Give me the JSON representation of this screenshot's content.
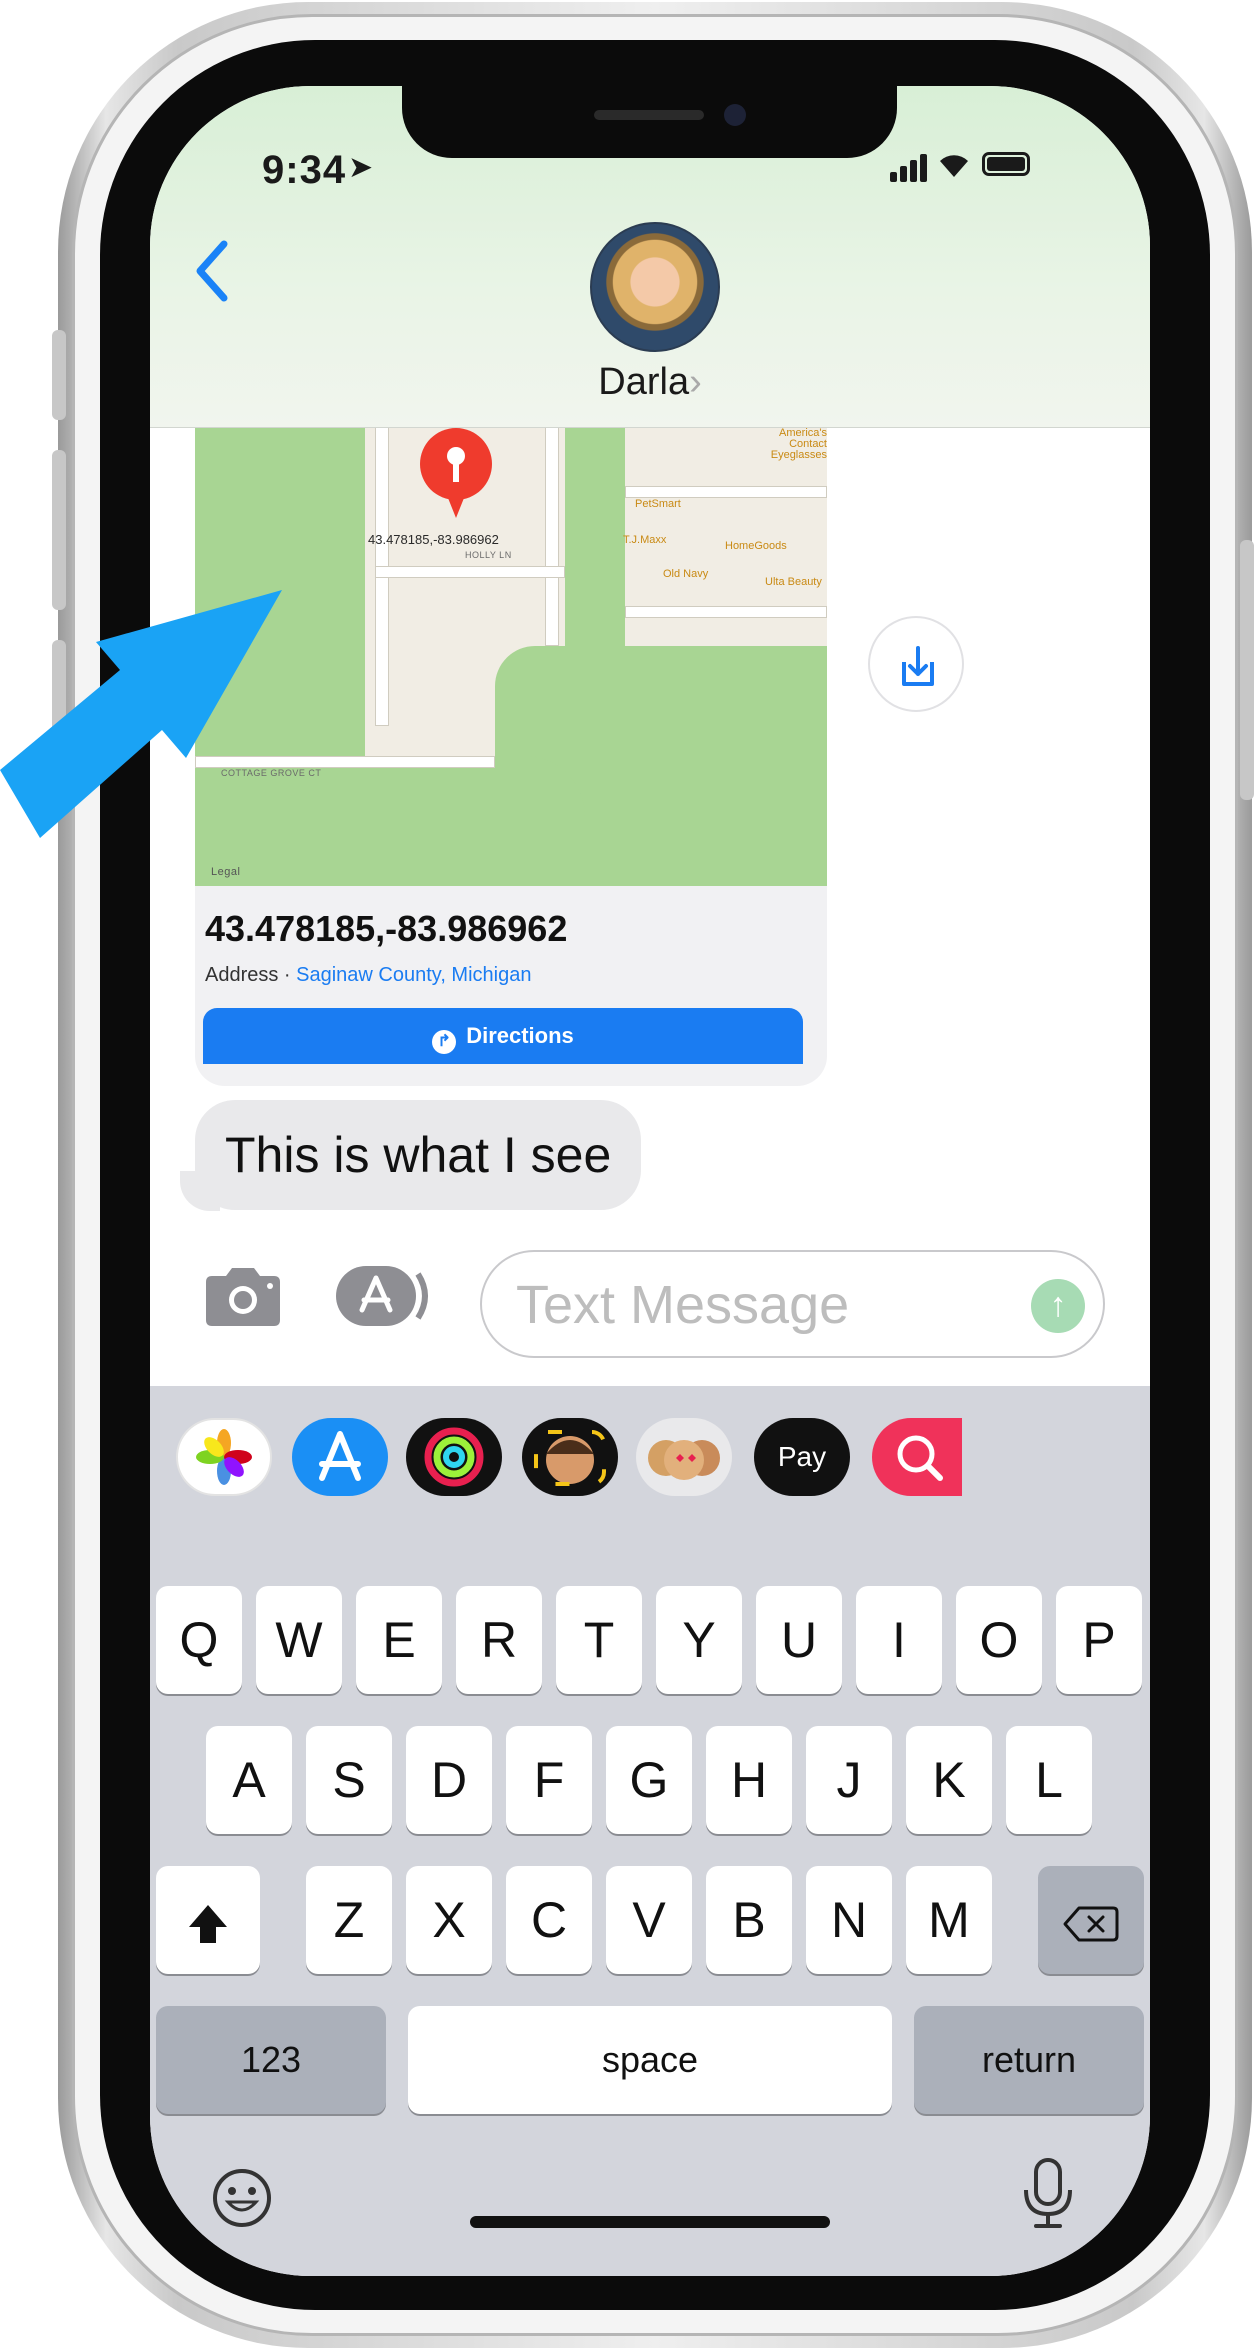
{
  "status_bar": {
    "time": "9:34"
  },
  "header": {
    "back_icon": "chevron-left-icon",
    "contact_name": "Darla",
    "contact_chevron": "›"
  },
  "map": {
    "pin_label": "43.478185,-83.986962",
    "pois": [
      "America's Contact Eyeglasses",
      "PetSmart",
      "T.J.Maxx",
      "HomeGoods",
      "Old Navy",
      "Ulta Beauty"
    ],
    "streets": [
      "HOLLY LN",
      "COTTAGE GROVE CT"
    ],
    "legal": "Legal"
  },
  "location_card": {
    "title": "43.478185,-83.986962",
    "sub_prefix": "Address · ",
    "sub_link": "Saginaw County, Michigan",
    "directions_label": "Directions"
  },
  "message": {
    "text": "This is what I see"
  },
  "input": {
    "placeholder": "Text Message"
  },
  "app_row": [
    "photos",
    "app-store",
    "activity",
    "memoji",
    "memoji-stickers",
    "apple-pay",
    "web-search"
  ],
  "keyboard": {
    "row1": [
      "Q",
      "W",
      "E",
      "R",
      "T",
      "Y",
      "U",
      "I",
      "O",
      "P"
    ],
    "row2": [
      "A",
      "S",
      "D",
      "F",
      "G",
      "H",
      "J",
      "K",
      "L"
    ],
    "row3": [
      "Z",
      "X",
      "C",
      "V",
      "B",
      "N",
      "M"
    ],
    "numbers_label": "123",
    "space_label": "space",
    "return_label": "return",
    "apple_pay_label": "Pay"
  },
  "colors": {
    "ios_blue": "#1a7cf2",
    "arrow_blue": "#1aa3f5",
    "keyboard_bg": "#d3d5dc",
    "bubble_gray": "#e9e9eb",
    "map_green": "#a8d593"
  }
}
